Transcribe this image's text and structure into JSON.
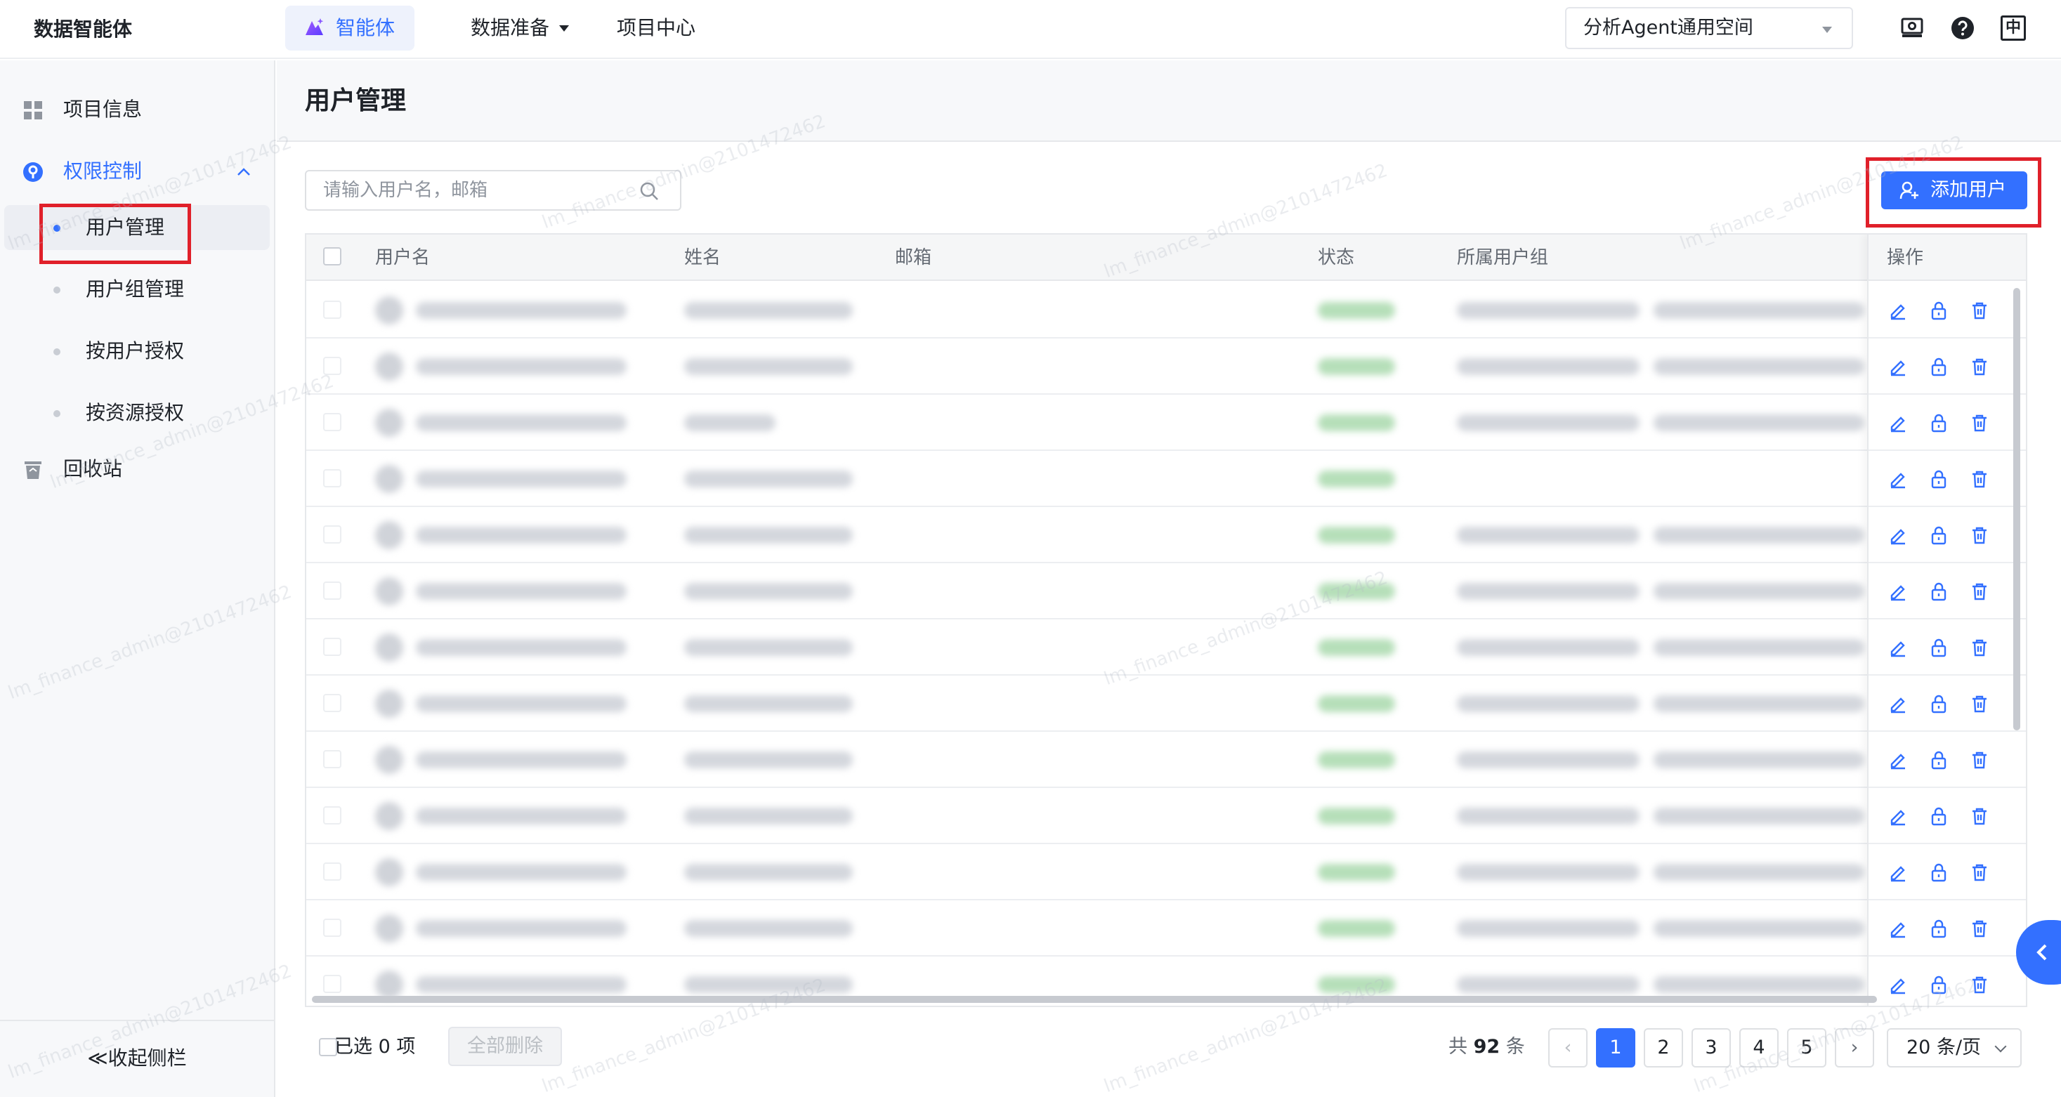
{
  "app": {
    "brand": "数据智能体"
  },
  "topnav": {
    "items": [
      {
        "label": "智能体"
      },
      {
        "label": "数据准备"
      },
      {
        "label": "项目中心"
      }
    ],
    "workspace": "分析Agent通用空间",
    "lang_label": "中"
  },
  "sidebar": {
    "items": [
      {
        "label": "项目信息"
      },
      {
        "label": "权限控制"
      },
      {
        "label": "回收站"
      }
    ],
    "sub_items": [
      {
        "label": "用户管理"
      },
      {
        "label": "用户组管理"
      },
      {
        "label": "按用户授权"
      },
      {
        "label": "按资源授权"
      }
    ],
    "collapse_label": "≪收起侧栏"
  },
  "page": {
    "title": "用户管理"
  },
  "search": {
    "placeholder": "请输入用户名，邮箱"
  },
  "toolbar": {
    "add_user_label": "添加用户"
  },
  "table": {
    "columns": {
      "username": "用户名",
      "name": "姓名",
      "email": "邮箱",
      "status": "状态",
      "group": "所属用户组",
      "actions": "操作"
    },
    "row_count": 13
  },
  "footer": {
    "selected_label": "已选 0 项",
    "delete_all_label": "全部删除",
    "total_prefix": "共",
    "total_count": "92",
    "total_suffix": "条",
    "pages": [
      "1",
      "2",
      "3",
      "4",
      "5"
    ],
    "page_size": "20 条/页"
  },
  "colors": {
    "accent": "#3370ff",
    "highlight_box": "#e0202a"
  },
  "watermark": "lm_finance_admin@2101472462"
}
